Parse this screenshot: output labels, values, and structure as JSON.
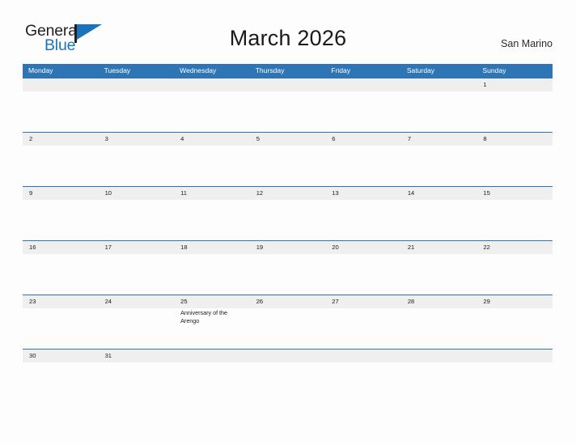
{
  "brand": {
    "word_one": "General",
    "word_two": "Blue",
    "flag_icon": "flag-triangle-icon",
    "color_dark": "#231f20",
    "color_blue": "#1b74bb"
  },
  "header": {
    "title": "March 2026",
    "locale": "San Marino"
  },
  "calendar": {
    "accent_color": "#2e75b6",
    "strip_color": "#efefef",
    "weekdays": [
      "Monday",
      "Tuesday",
      "Wednesday",
      "Thursday",
      "Friday",
      "Saturday",
      "Sunday"
    ],
    "weeks": [
      [
        {
          "day": ""
        },
        {
          "day": ""
        },
        {
          "day": ""
        },
        {
          "day": ""
        },
        {
          "day": ""
        },
        {
          "day": ""
        },
        {
          "day": "1"
        }
      ],
      [
        {
          "day": "2"
        },
        {
          "day": "3"
        },
        {
          "day": "4"
        },
        {
          "day": "5"
        },
        {
          "day": "6"
        },
        {
          "day": "7"
        },
        {
          "day": "8"
        }
      ],
      [
        {
          "day": "9"
        },
        {
          "day": "10"
        },
        {
          "day": "11"
        },
        {
          "day": "12"
        },
        {
          "day": "13"
        },
        {
          "day": "14"
        },
        {
          "day": "15"
        }
      ],
      [
        {
          "day": "16"
        },
        {
          "day": "17"
        },
        {
          "day": "18"
        },
        {
          "day": "19"
        },
        {
          "day": "20"
        },
        {
          "day": "21"
        },
        {
          "day": "22"
        }
      ],
      [
        {
          "day": "23"
        },
        {
          "day": "24"
        },
        {
          "day": "25",
          "event": "Anniversary of the Arengo"
        },
        {
          "day": "26"
        },
        {
          "day": "27"
        },
        {
          "day": "28"
        },
        {
          "day": "29"
        }
      ],
      [
        {
          "day": "30"
        },
        {
          "day": "31"
        },
        {
          "day": ""
        },
        {
          "day": ""
        },
        {
          "day": ""
        },
        {
          "day": ""
        },
        {
          "day": ""
        }
      ]
    ]
  }
}
